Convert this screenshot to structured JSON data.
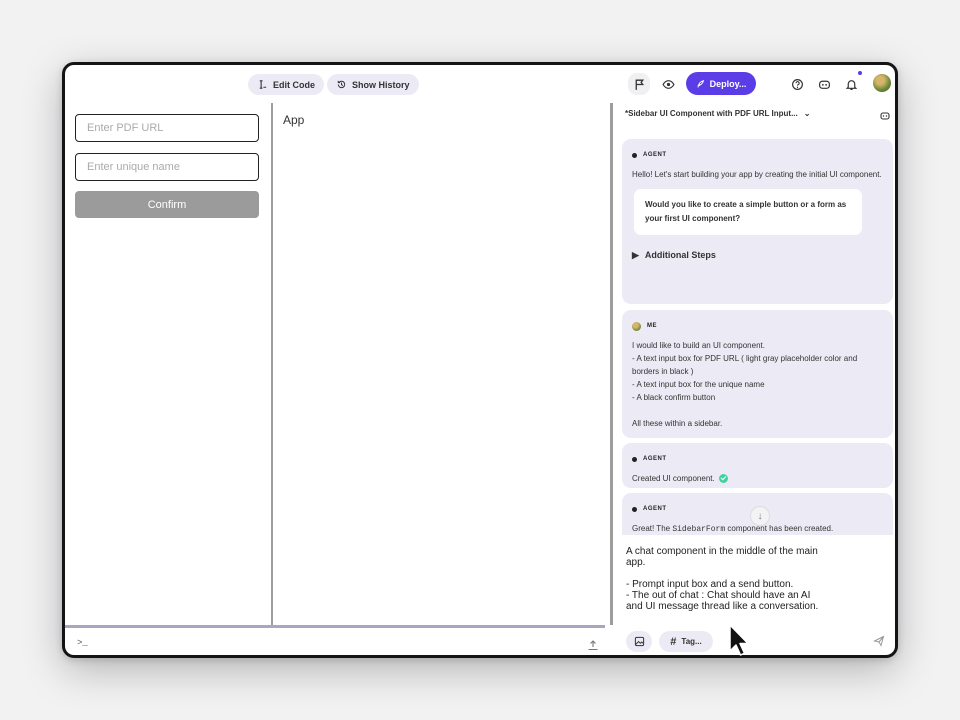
{
  "toolbar": {
    "edit_code_label": "Edit Code",
    "show_history_label": "Show History",
    "deploy_label": "Deploy..."
  },
  "form": {
    "pdf_url_placeholder": "Enter PDF URL",
    "unique_name_placeholder": "Enter unique name",
    "confirm_label": "Confirm"
  },
  "app": {
    "label": "App"
  },
  "terminal": {
    "prompt": ">_"
  },
  "chat": {
    "title": "*Sidebar UI Component with PDF URL Input...",
    "messages": [
      {
        "role": "AGENT",
        "text": "Hello! Let's start building your app by creating the initial UI component.",
        "question": "Would you like to create a simple button or a form as your first UI component?",
        "steps_label": "Additional Steps"
      },
      {
        "role": "ME",
        "lines": [
          "I would like to build an UI component.",
          "- A text input box for PDF URL ( light gray placeholder color and borders in black )",
          "- A text input box for the unique name",
          "- A black confirm button",
          "",
          "All these within a sidebar."
        ]
      },
      {
        "role": "AGENT",
        "text": "Created UI component."
      },
      {
        "role": "AGENT",
        "text_before": "Great! The ",
        "code": "SidebarForm",
        "text_after": " component has been created."
      }
    ],
    "prompt_text": "A chat component in the middle of the main app.\n\n- Prompt input box and a send button.\n- The out of chat : Chat should have an AI and UI message thread like a conversation.",
    "tag_label": "Tag..."
  },
  "colors": {
    "accent": "#5b3de8",
    "bubble": "#ecebf5",
    "success": "#3fd3a2"
  }
}
